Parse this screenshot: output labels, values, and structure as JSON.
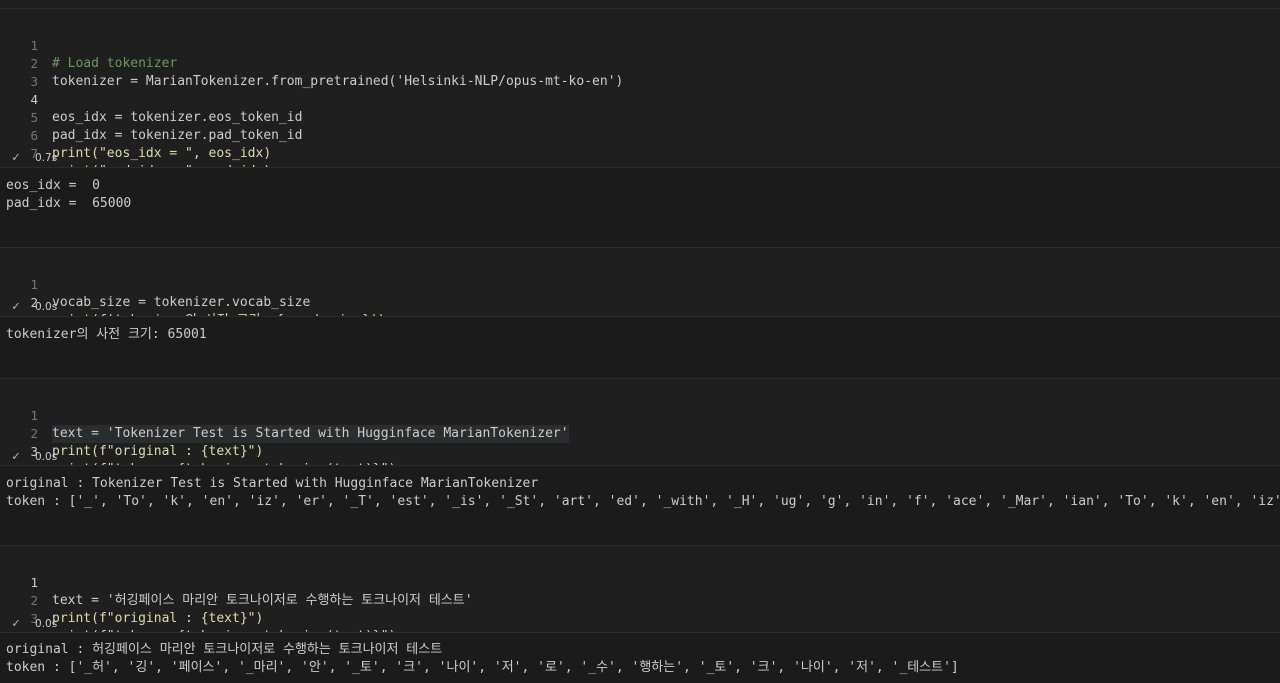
{
  "cells": [
    {
      "lines": [
        {
          "n": "1",
          "text": "# Load tokenizer"
        },
        {
          "n": "2",
          "text": "tokenizer = MarianTokenizer.from_pretrained('Helsinki-NLP/opus-mt-ko-en')"
        },
        {
          "n": "3",
          "text": ""
        },
        {
          "n": "4",
          "text": "eos_idx = tokenizer.eos_token_id"
        },
        {
          "n": "5",
          "text": "pad_idx = tokenizer.pad_token_id"
        },
        {
          "n": "6",
          "text": "print(\"eos_idx = \", eos_idx)"
        },
        {
          "n": "7",
          "text": "print(\"pad_idx = \", pad_idx)"
        }
      ],
      "status": {
        "check": "✓",
        "time": "0.7s"
      },
      "output": [
        "eos_idx =  0",
        "pad_idx =  65000"
      ]
    },
    {
      "lines": [
        {
          "n": "1",
          "text": "vocab_size = tokenizer.vocab_size"
        },
        {
          "n": "2",
          "text": "print(f'tokenizer의 사전 크기: {vocab_size}')"
        }
      ],
      "status": {
        "check": "✓",
        "time": "0.0s"
      },
      "output": [
        "tokenizer의 사전 크기: 65001"
      ]
    },
    {
      "lines": [
        {
          "n": "1",
          "text": "text = 'Tokenizer Test is Started with Hugginface MarianTokenizer'"
        },
        {
          "n": "2",
          "text": "print(f\"original : {text}\")"
        },
        {
          "n": "3",
          "text": "print(f\"token : {tokenizer.tokenize(text)}\")"
        }
      ],
      "status": {
        "check": "✓",
        "time": "0.0s"
      },
      "output": [
        "original : Tokenizer Test is Started with Hugginface MarianTokenizer",
        "token : ['_', 'To', 'k', 'en', 'iz', 'er', '_T', 'est', '_is', '_St', 'art', 'ed', '_with', '_H', 'ug', 'g', 'in', 'f', 'ace', '_Mar', 'ian', 'To', 'k', 'en', 'iz', 'er']"
      ]
    },
    {
      "lines": [
        {
          "n": "1",
          "text": "text = '허깅페이스 마리안 토크나이저로 수행하는 토크나이저 테스트'"
        },
        {
          "n": "2",
          "text": "print(f\"original : {text}\")"
        },
        {
          "n": "3",
          "text": "print(f\"token : {tokenizer.tokenize(text)}\")"
        }
      ],
      "status": {
        "check": "✓",
        "time": "0.0s"
      },
      "output": [
        "original : 허깅페이스 마리안 토크나이저로 수행하는 토크나이저 테스트",
        "token : ['_허', '깅', '페이스', '_마리', '안', '_토', '크', '나이', '저', '로', '_수', '행하는', '_토', '크', '나이', '저', '_테스트']"
      ]
    }
  ],
  "colors": {
    "background": "#1f1f1f",
    "output_background": "#1b1b1b",
    "check": "#89d185",
    "string": "#ce9178",
    "function": "#dcdcaa",
    "comment": "#6a9955"
  }
}
